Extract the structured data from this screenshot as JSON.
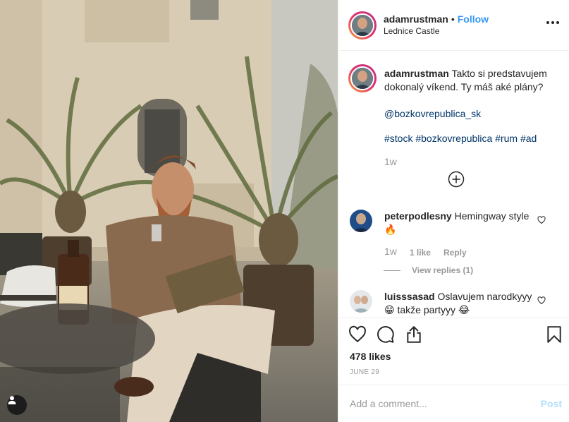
{
  "post": {
    "username": "adamrustman",
    "separator": "•",
    "follow_label": "Follow",
    "location": "Lednice Castle",
    "caption": {
      "username": "adamrustman",
      "text": "Takto si predstavujem dokonalý víkend. Ty máš aké plány?",
      "mention": "@bozkovrepublica_sk",
      "hashtags": "#stock #bozkovrepublica #rum #ad",
      "time": "1w"
    }
  },
  "comments": [
    {
      "username": "peterpodlesny",
      "text": "Hemingway style",
      "emoji": "🔥",
      "time": "1w",
      "likes": "1 like",
      "reply_label": "Reply",
      "view_replies": "View replies (1)"
    },
    {
      "username": "luisssasad",
      "text": "Oslavujem narodkyyy",
      "text2": "😁 takže partyyy 😂"
    }
  ],
  "stats": {
    "likes": "478 likes",
    "date": "JUNE 29"
  },
  "add_comment": {
    "placeholder": "Add a comment...",
    "post_label": "Post"
  },
  "icons": {
    "like": "heart-icon",
    "comment": "comment-icon",
    "share": "share-icon",
    "save": "bookmark-icon",
    "more": "more-icon",
    "load_more": "plus-circle-icon",
    "tag": "user-tag-icon"
  },
  "colors": {
    "follow": "#3897f0",
    "link": "#003569",
    "muted": "#999999",
    "post_disabled": "#b2dffc"
  }
}
